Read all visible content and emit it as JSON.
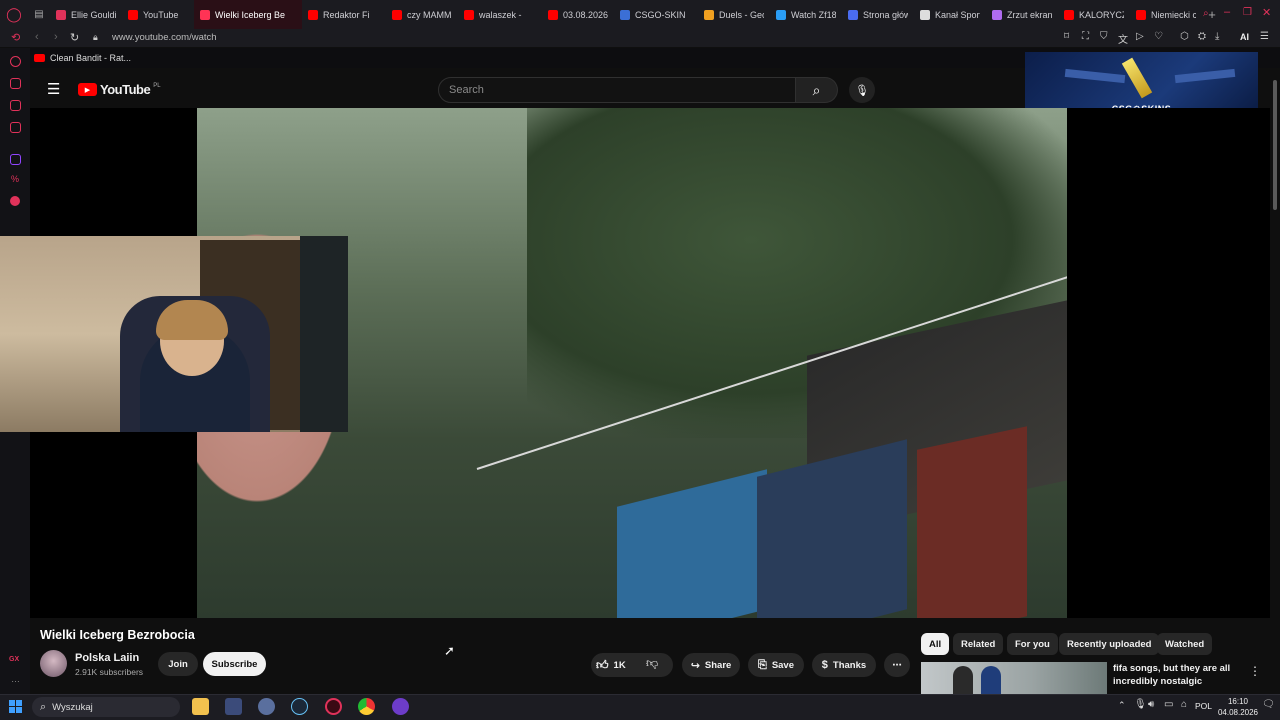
{
  "browser": {
    "tabs": [
      {
        "label": "Ellie Goulding",
        "color": "#e0325a",
        "active": false
      },
      {
        "label": "YouTube",
        "color": "#ff0000",
        "active": false
      },
      {
        "label": "Wielki Iceberg Be",
        "color": "#ff3355",
        "active": true
      },
      {
        "label": "Redaktor Fi",
        "color": "#ff0000",
        "active": false
      },
      {
        "label": "czy MAMM",
        "color": "#ff0000",
        "active": false
      },
      {
        "label": "walaszek -",
        "color": "#ff0000",
        "active": false
      },
      {
        "label": "03.08.2026",
        "color": "#ff0000",
        "active": false
      },
      {
        "label": "CSGO-SKIN",
        "color": "#3b6fd6",
        "active": false
      },
      {
        "label": "Duels - Geo",
        "color": "#f0a020",
        "active": false
      },
      {
        "label": "Watch Zf18",
        "color": "#2a9df4",
        "active": false
      },
      {
        "label": "Strona głów",
        "color": "#4a6cf0",
        "active": false
      },
      {
        "label": "Kanał Sport",
        "color": "#dddddd",
        "active": false
      },
      {
        "label": "Zrzut ekran",
        "color": "#b06cf0",
        "active": false
      },
      {
        "label": "KALORYCZ",
        "color": "#ff0000",
        "active": false
      },
      {
        "label": "Niemiecki c",
        "color": "#ff0000",
        "active": false
      }
    ],
    "url": "www.youtube.com/watch",
    "bookmark": "Clean Bandit - Rat...",
    "ai_label": "AI"
  },
  "youtube": {
    "logo_text": "YouTube",
    "region": "PL",
    "search_placeholder": "Search",
    "video_title": "Wielki Iceberg Bezrobocia",
    "channel_name": "Polska Laiin",
    "subscribers": "2.91K subscribers",
    "join_label": "Join",
    "subscribe_label": "Subscribe",
    "likes": "1K",
    "share_label": "Share",
    "save_label": "Save",
    "thanks_label": "Thanks",
    "chips": [
      "All",
      "Related",
      "For you",
      "Recently uploaded",
      "Watched"
    ],
    "rec_title": "fifa songs, but they are all incredibly nostalgic"
  },
  "ad": {
    "brand": "CSG⚙SKINS"
  },
  "taskbar": {
    "search_label": "Wyszukaj",
    "lang": "POL",
    "time": "16:10",
    "date": "04.08.2026"
  }
}
